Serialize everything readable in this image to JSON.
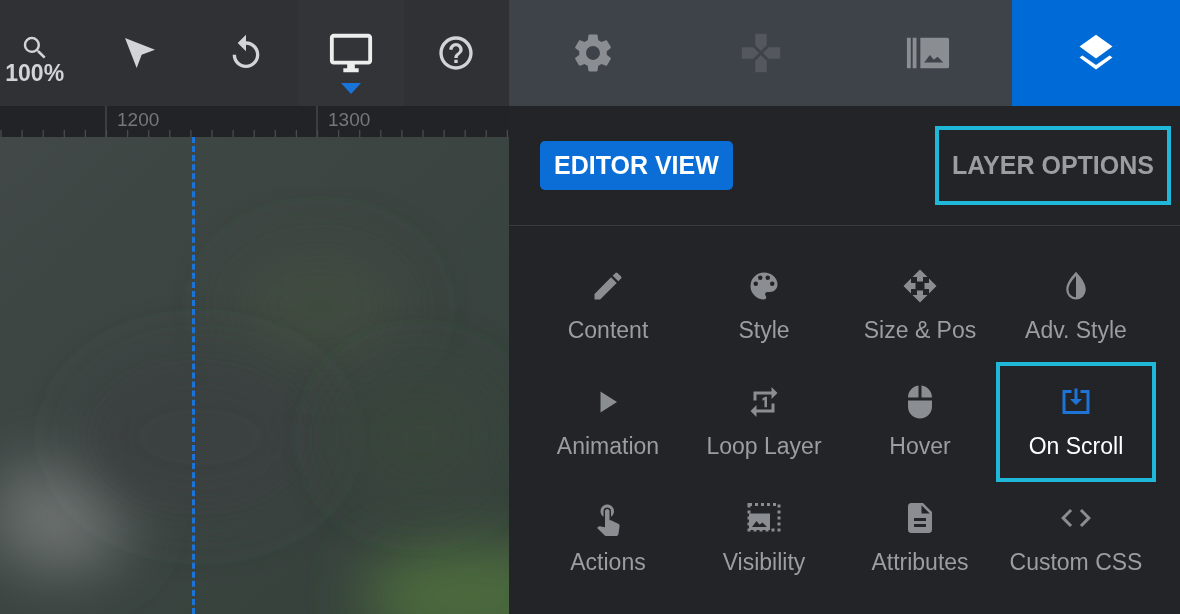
{
  "toolbar": {
    "items": [
      {
        "kind": "zoom",
        "label": "100%",
        "selected": false
      },
      {
        "kind": "pointer",
        "selected": false
      },
      {
        "kind": "undo",
        "selected": false
      },
      {
        "kind": "desktop",
        "selected": true
      },
      {
        "kind": "help",
        "selected": false
      }
    ]
  },
  "ruler": {
    "labels": [
      "1200",
      "1300"
    ]
  },
  "tabs": [
    {
      "kind": "settings",
      "selected": false,
      "disabled": false
    },
    {
      "kind": "gamepad",
      "selected": false,
      "disabled": true
    },
    {
      "kind": "media",
      "selected": false,
      "disabled": false
    },
    {
      "kind": "layers",
      "selected": true,
      "disabled": false
    }
  ],
  "views": [
    {
      "label": "EDITOR VIEW",
      "selected": true,
      "highlighted": false
    },
    {
      "label": "LAYER OPTIONS",
      "selected": false,
      "highlighted": true
    }
  ],
  "options": [
    {
      "kind": "pencil",
      "label": "Content",
      "selected": false
    },
    {
      "kind": "palette",
      "label": "Style",
      "selected": false
    },
    {
      "kind": "move",
      "label": "Size & Pos",
      "selected": false
    },
    {
      "kind": "drop",
      "label": "Adv. Style",
      "selected": false
    },
    {
      "kind": "play",
      "label": "Animation",
      "selected": false
    },
    {
      "kind": "loop",
      "label": "Loop Layer",
      "selected": false
    },
    {
      "kind": "mouse",
      "label": "Hover",
      "selected": false
    },
    {
      "kind": "scroll",
      "label": "On Scroll",
      "selected": true
    },
    {
      "kind": "touch",
      "label": "Actions",
      "selected": false
    },
    {
      "kind": "visibility",
      "label": "Visibility",
      "selected": false
    },
    {
      "kind": "document",
      "label": "Attributes",
      "selected": false
    },
    {
      "kind": "code",
      "label": "Custom CSS",
      "selected": false
    }
  ]
}
